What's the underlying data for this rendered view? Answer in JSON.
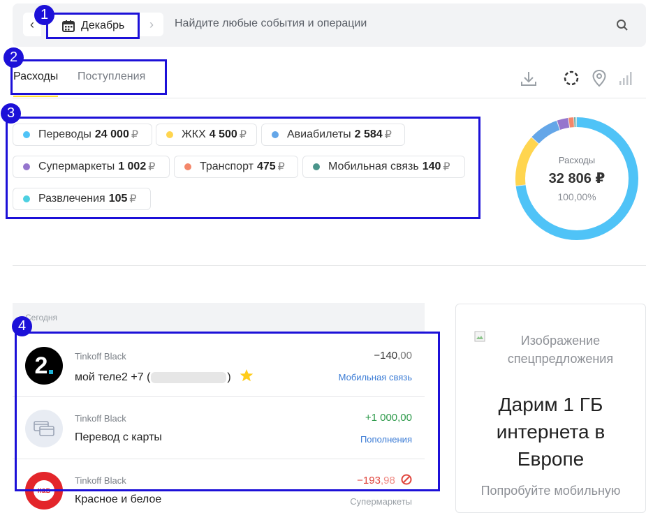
{
  "topbar": {
    "month_label": "Декабрь",
    "search_placeholder": "Найдите любые события и операции",
    "prev_glyph": "‹",
    "next_glyph": "›"
  },
  "tabs": [
    {
      "label": "Расходы",
      "active": true
    },
    {
      "label": "Поступления",
      "active": false
    }
  ],
  "categories": [
    {
      "name": "Переводы",
      "amount": "24 000",
      "currency": "₽",
      "color": "#4fc3f7"
    },
    {
      "name": "ЖКХ",
      "amount": "4 500",
      "currency": "₽",
      "color": "#ffd54f"
    },
    {
      "name": "Авиабилеты",
      "amount": "2 584",
      "currency": "₽",
      "color": "#64a6e8"
    },
    {
      "name": "Супермаркеты",
      "amount": "1 002",
      "currency": "₽",
      "color": "#9575cd"
    },
    {
      "name": "Транспорт",
      "amount": "475",
      "currency": "₽",
      "color": "#f4876a"
    },
    {
      "name": "Мобильная связь",
      "amount": "140",
      "currency": "₽",
      "color": "#4a958b"
    },
    {
      "name": "Развлечения",
      "amount": "105",
      "currency": "₽",
      "color": "#4dd0e1"
    }
  ],
  "summary": {
    "label": "Расходы",
    "total": "32 806 ₽",
    "percent": "100,00%"
  },
  "chart_data": {
    "type": "pie",
    "categories": [
      "Переводы",
      "ЖКХ",
      "Авиабилеты",
      "Супермаркеты",
      "Транспорт",
      "Мобильная связь",
      "Развлечения"
    ],
    "values": [
      24000,
      4500,
      2584,
      1002,
      475,
      140,
      105
    ],
    "colors": [
      "#4fc3f7",
      "#ffd54f",
      "#64a6e8",
      "#9575cd",
      "#f4876a",
      "#4a958b",
      "#4dd0e1"
    ],
    "title": "Расходы"
  },
  "operations": {
    "group_label": "Сегодня",
    "items": [
      {
        "card": "Tinkoff Black",
        "title": "мой теле2 +7 (",
        "title_tail": ")",
        "amount_main": "−140",
        "amount_dec": ",00",
        "category": "Мобильная связь",
        "amount_color": "#333333"
      },
      {
        "card": "Tinkoff Black",
        "title": "Перевод с карты",
        "amount_main": "+1 000",
        "amount_dec": ",00",
        "category": "Пополнения",
        "amount_color": "#2e9a4b"
      },
      {
        "card": "Tinkoff Black",
        "title": "Красное и белое",
        "amount_main": "−193",
        "amount_dec": ",98",
        "category": "Супермаркеты",
        "amount_color": "#e0443c"
      }
    ],
    "logo_tele2_text": "2",
    "logo_kb_text": "К&Б"
  },
  "promo": {
    "image_alt": "Изображение спецпредложения",
    "title": "Дарим 1 ГБ интернета в Европе",
    "subtitle": "Попробуйте мобильную"
  },
  "annotations": [
    "1",
    "2",
    "3",
    "4"
  ]
}
